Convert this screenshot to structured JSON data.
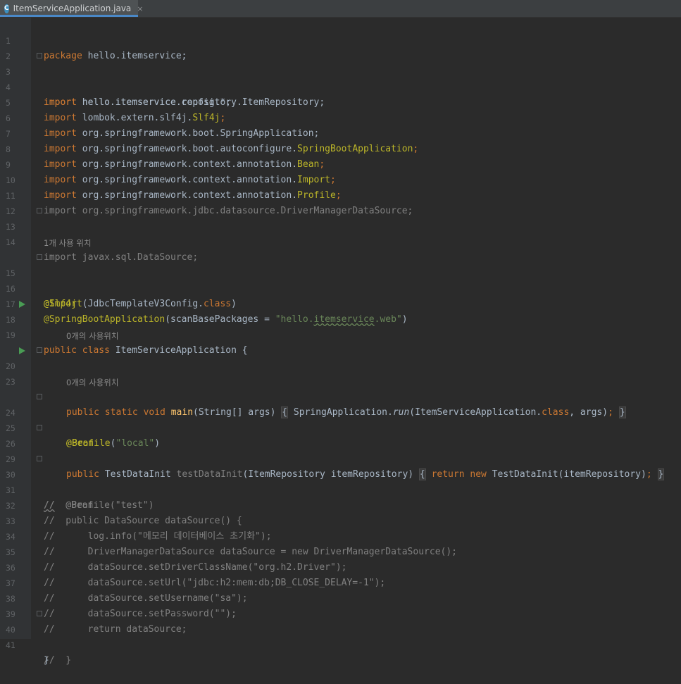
{
  "tab": {
    "filename": "ItemServiceApplication.java",
    "close": "×",
    "icon": "C"
  },
  "hints": {
    "class_usages": "1개 사용 위치",
    "main_usages": "0개의 사용위치",
    "bean_usages": "0개의 사용위치"
  },
  "lines": {
    "l1": [
      "1",
      "package",
      " hello.itemservice;"
    ],
    "l3": [
      "3",
      "import",
      " hello.itemservice.config.*;"
    ],
    "l4": [
      "4",
      "import",
      " hello.itemservice.repository.ItemRepository;"
    ],
    "l5a": [
      "5",
      "import",
      " lombok.extern.slf4j.",
      "Slf4j",
      ";"
    ],
    "l6": [
      "6",
      "import",
      " org.springframework.boot.SpringApplication;"
    ],
    "l7": [
      "7",
      "import",
      " org.springframework.boot.autoconfigure.",
      "SpringBootApplication",
      ";"
    ],
    "l8": [
      "8",
      "import",
      " org.springframework.context.annotation.",
      "Bean",
      ";"
    ],
    "l9": [
      "9",
      "import",
      " org.springframework.context.annotation.",
      "Import",
      ";"
    ],
    "l10": [
      "10",
      "import",
      " org.springframework.context.annotation.",
      "Profile",
      ";"
    ],
    "l11": [
      "11",
      "import org.springframework.jdbc.datasource.DriverManagerDataSource;"
    ],
    "l13": [
      "13",
      "import javax.sql.DataSource;"
    ],
    "l15": [
      "15",
      "@Slf4j"
    ],
    "l16": [
      "16",
      "@Import",
      "(JdbcTemplateV3Config.",
      "class",
      ")"
    ],
    "l17": [
      "17",
      "@SpringBootApplication",
      "(scanBasePackages = ",
      "\"hello.",
      "itemservice",
      ".web\"",
      ")"
    ],
    "l18": [
      "18",
      "public class",
      " ItemServiceApplication {"
    ],
    "l20": [
      "20",
      "public static void",
      " ",
      "main",
      "(String[] args) ",
      "{",
      " SpringApplication.",
      "run",
      "(ItemServiceApplication.",
      "class",
      ", args)",
      ";",
      " ",
      "}"
    ],
    "l24": [
      "24",
      "@Bean"
    ],
    "l25": [
      "25",
      "@Profile",
      "(",
      "\"local\"",
      ")"
    ],
    "l26": [
      "26",
      "public",
      " TestDataInit ",
      "testDataInit",
      "(ItemRepository itemRepository) ",
      "{",
      " ",
      "return new",
      " TestDataInit(itemRepository)",
      ";",
      " ",
      "}"
    ],
    "l30": [
      "30",
      "//",
      "  @Bean"
    ],
    "l31": [
      "31",
      "//  @Profile(\"test\")"
    ],
    "l32": [
      "32",
      "//  public DataSource dataSource() {"
    ],
    "l33": [
      "33",
      "//      log.info(\"메모리 데이터베이스 초기화\");"
    ],
    "l34": [
      "34",
      "//      DriverManagerDataSource dataSource = new DriverManagerDataSource();"
    ],
    "l35": [
      "35",
      "//      dataSource.setDriverClassName(\"org.h2.Driver\");"
    ],
    "l36": [
      "36",
      "//      dataSource.setUrl(\"jdbc:h2:mem:db;DB_CLOSE_DELAY=-1\");"
    ],
    "l37": [
      "37",
      "//      dataSource.setUsername(\"sa\");"
    ],
    "l38": [
      "38",
      "//      dataSource.setPassword(\"\");"
    ],
    "l39": [
      "39",
      "//      return dataSource;"
    ],
    "l40": [
      "40",
      "//  }"
    ],
    "l41": [
      "41",
      "}"
    ]
  },
  "empty_lines": {
    "l2": "2",
    "l12": "12",
    "l14": "14",
    "l19": "19",
    "l23": "23",
    "l29": "29"
  },
  "colors": {
    "keyword": "#cc7832",
    "annotation": "#bbb529",
    "string": "#6a8759",
    "comment": "#808080",
    "method": "#ffc66d",
    "run_icon": "#499c54"
  }
}
